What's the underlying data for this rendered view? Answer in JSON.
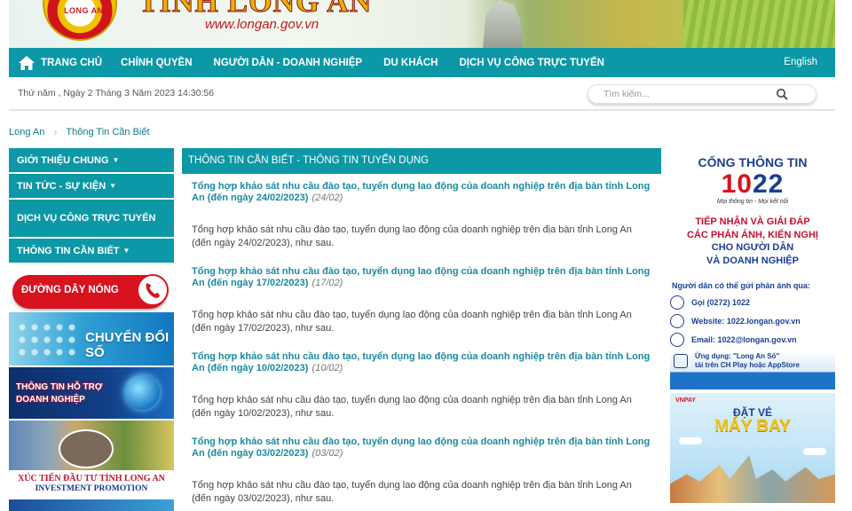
{
  "header": {
    "site_title": "TỈNH LONG AN",
    "logo_text": "LONG AN",
    "url": "www.longan.gov.vn"
  },
  "nav": {
    "items": [
      "TRANG CHỦ",
      "CHÍNH QUYỀN",
      "NGƯỜI DÂN - DOANH NGHIỆP",
      "DU KHÁCH",
      "DỊCH VỤ CÔNG TRỰC TUYẾN"
    ],
    "english": "English"
  },
  "datebar": {
    "date": "Thứ năm , Ngày 2 Tháng 3 Năm 2023 14:30:56",
    "search_placeholder": "Tìm kiếm..."
  },
  "breadcrumb": [
    "Long An",
    "Thông Tin Cần Biết"
  ],
  "sidebar": {
    "menu": [
      "GIỚI THIỆU CHUNG",
      "TIN TỨC - SỰ KIỆN",
      "DỊCH VỤ CÔNG TRỰC TUYẾN",
      "THÔNG TIN CẦN BIẾT"
    ],
    "hotline": "ĐƯỜNG DÂY NÓNG",
    "chuyen_doi_so": "CHUYỂN ĐỔI SỐ",
    "ho_tro_dn": [
      "THÔNG TIN HỖ TRỢ",
      "DOANH NGHIỆP"
    ],
    "xuc_tien_vi": "XÚC TIẾN ĐẦU TƯ TỈNH LONG AN",
    "xuc_tien_en": "INVESTMENT PROMOTION"
  },
  "main": {
    "header": "THÔNG TIN CẦN BIẾT - THÔNG TIN TUYỂN DỤNG",
    "news": [
      {
        "title": "Tổng hợp khảo sát nhu cầu đào tạo, tuyển dụng lao động của doanh nghiệp trên địa bàn tỉnh Long An (đến ngày 24/02/2023)",
        "date": "(24/02)",
        "desc": "Tổng hợp khảo sát nhu cầu đào tạo, tuyển dụng lao động của doanh nghiệp trên địa bàn tỉnh Long An (đến ngày 24/02/2023), như sau."
      },
      {
        "title": "Tổng hợp khảo sát nhu cầu đào tạo, tuyển dụng lao động của doanh nghiệp trên địa bàn tỉnh Long An (đến ngày 17/02/2023)",
        "date": "(17/02)",
        "desc": "Tổng hợp khảo sát nhu cầu đào tạo, tuyển dụng lao động của doanh nghiệp trên địa bàn tỉnh Long An (đến ngày 17/02/2023), như sau."
      },
      {
        "title": "Tổng hợp khảo sát nhu cầu đào tạo, tuyển dụng lao động của doanh nghiệp trên địa bàn tỉnh Long An (đến ngày 10/02/2023)",
        "date": "(10/02)",
        "desc": "Tổng hợp khảo sát nhu cầu đào tạo, tuyển dụng lao động của doanh nghiệp trên địa bàn tỉnh Long An (đến ngày 10/02/2023), như sau."
      },
      {
        "title": "Tổng hợp khảo sát nhu cầu đào tạo, tuyển dụng lao động của doanh nghiệp trên địa bàn tỉnh Long An (đến ngày 03/02/2023)",
        "date": "(03/02)",
        "desc": "Tổng hợp khảo sát nhu cầu đào tạo, tuyển dụng lao động của doanh nghiệp trên địa bàn tỉnh Long An (đến ngày 03/02/2023), như sau."
      }
    ]
  },
  "right": {
    "ad1022": {
      "heading": "CỔNG THÔNG TIN",
      "number_a": "10",
      "number_b": "22",
      "tagline": "Mọi thông tin - Mọi kết nối",
      "body": [
        "TIẾP NHẬN VÀ GIẢI ĐÁP",
        "CÁC PHẢN ÁNH, KIẾN NGHỊ",
        "CHO NGƯỜI DÂN",
        "VÀ DOANH NGHIỆP"
      ],
      "sub": "Người dân có thể gửi phản ánh qua:",
      "phone": "Gọi (0272) 1022",
      "website": "Website: 1022.longan.gov.vn",
      "email": "Email: 1022@longan.gov.vn",
      "app_line1": "Ứng dụng: \"Long An Số\"",
      "app_line2": "tải trên CH Play hoặc AppStore"
    },
    "plane_ad": {
      "brand": "VNPAY",
      "line1": "ĐẶT VÉ",
      "line2": "MÁY BAY"
    }
  },
  "colors": {
    "primary_teal": "#0c98a6",
    "link_teal": "#1a8aa0",
    "hotline_red": "#d9121f",
    "brand_blue": "#1b3f94"
  }
}
